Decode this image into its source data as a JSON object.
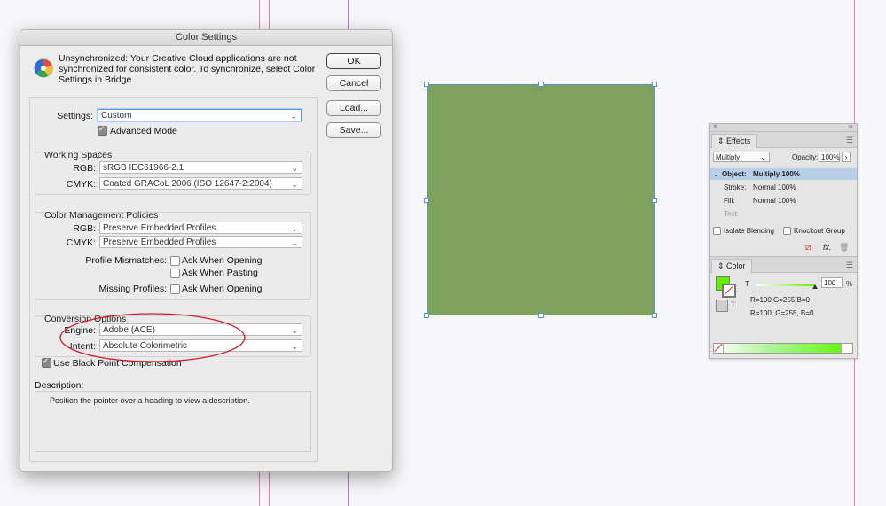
{
  "colors": {
    "fill_swatch": "#66ee00",
    "square": "#7ea25b",
    "selection": "#5d8fd1"
  },
  "dialog": {
    "title": "Color Settings",
    "warning_text": "Unsynchronized: Your Creative Cloud applications are not synchronized for consistent color. To synchronize, select Color Settings in Bridge.",
    "buttons": {
      "ok": "OK",
      "cancel": "Cancel",
      "load": "Load...",
      "save": "Save..."
    },
    "settings_label": "Settings:",
    "settings_value": "Custom",
    "advanced_mode": "Advanced Mode",
    "working_spaces": {
      "legend": "Working Spaces",
      "rgb_label": "RGB:",
      "rgb_value": "sRGB IEC61966-2.1",
      "cmyk_label": "CMYK:",
      "cmyk_value": "Coated GRACoL 2006 (ISO 12647-2:2004)"
    },
    "policies": {
      "legend": "Color Management Policies",
      "rgb_label": "RGB:",
      "rgb_value": "Preserve Embedded Profiles",
      "cmyk_label": "CMYK:",
      "cmyk_value": "Preserve Embedded Profiles",
      "mismatch_label": "Profile Mismatches:",
      "ask_opening": "Ask When Opening",
      "ask_pasting": "Ask When Pasting",
      "missing_label": "Missing Profiles:",
      "missing_ask_opening": "Ask When Opening"
    },
    "conversion": {
      "legend": "Conversion Options",
      "engine_label": "Engine:",
      "engine_value": "Adobe (ACE)",
      "intent_label": "Intent:",
      "intent_value": "Absolute Colorimetric",
      "black_point": "Use Black Point Compensation"
    },
    "description_label": "Description:",
    "description_text": "Position the pointer over a heading to view a description."
  },
  "effects_panel": {
    "tab": "Effects",
    "blend_mode": "Multiply",
    "opacity_label": "Opacity:",
    "opacity_value": "100%",
    "object_label": "Object:",
    "object_value": "Multiply 100%",
    "stroke_label": "Stroke:",
    "stroke_value": "Normal 100%",
    "fill_label": "Fill:",
    "fill_value": "Normal 100%",
    "text_label": "Text:",
    "isolate": "Isolate Blending",
    "knockout": "Knockout Group",
    "fx": "fx."
  },
  "color_panel": {
    "tab": "Color",
    "tint_label": "T",
    "tint_value": "100",
    "percent": "%",
    "text_icon": "T",
    "rgb_readout_1": "R=100 G=255 B=0",
    "rgb_readout_2": "R=100, G=255, B=0"
  }
}
